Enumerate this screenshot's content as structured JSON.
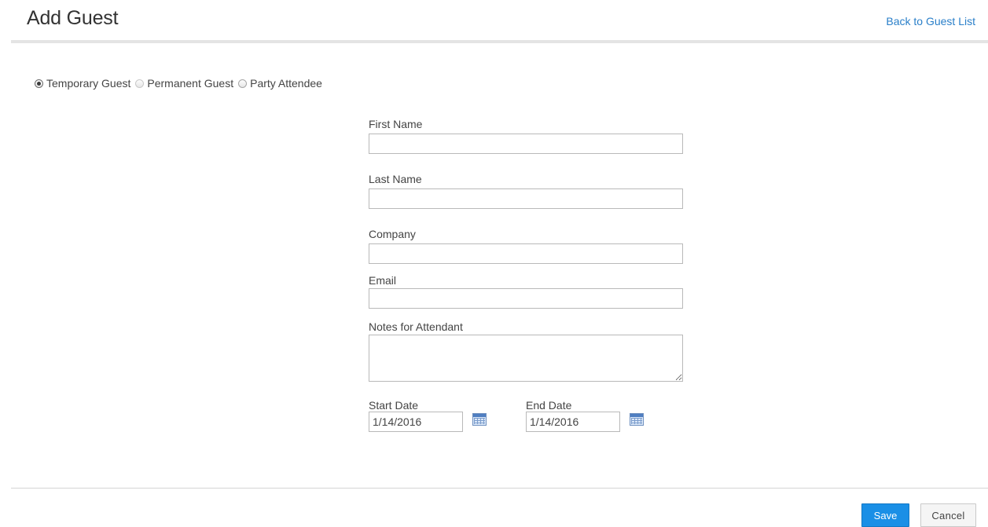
{
  "header": {
    "title": "Add Guest",
    "back_link": "Back to Guest List"
  },
  "guest_type": {
    "options": [
      {
        "label": "Temporary Guest",
        "selected": true
      },
      {
        "label": "Permanent Guest",
        "selected": false
      },
      {
        "label": "Party Attendee",
        "selected": false
      }
    ]
  },
  "form": {
    "first_name": {
      "label": "First Name",
      "value": ""
    },
    "last_name": {
      "label": "Last Name",
      "value": ""
    },
    "company": {
      "label": "Company",
      "value": ""
    },
    "email": {
      "label": "Email",
      "value": ""
    },
    "notes": {
      "label": "Notes for Attendant",
      "value": ""
    },
    "start_date": {
      "label": "Start Date",
      "value": "1/14/2016"
    },
    "end_date": {
      "label": "End Date",
      "value": "1/14/2016"
    }
  },
  "actions": {
    "save_label": "Save",
    "cancel_label": "Cancel"
  },
  "colors": {
    "link": "#2a7fc9",
    "primary_button": "#1a8fe6"
  }
}
